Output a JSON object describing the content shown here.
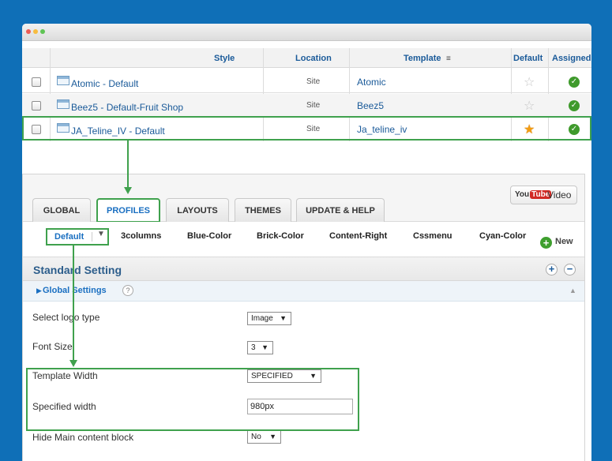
{
  "table": {
    "columns": {
      "style": "Style",
      "location": "Location",
      "template": "Template",
      "default": "Default",
      "assigned": "Assigned"
    },
    "rows": [
      {
        "style": "Atomic - Default",
        "location": "Site",
        "template": "Atomic",
        "is_default": false
      },
      {
        "style": "Beez5 - Default-Fruit Shop",
        "location": "Site",
        "template": "Beez5",
        "is_default": false
      },
      {
        "style": "JA_Teline_IV - Default",
        "location": "Site",
        "template": "Ja_teline_iv",
        "is_default": true
      }
    ]
  },
  "tabs": [
    "GLOBAL",
    "PROFILES",
    "LAYOUTS",
    "THEMES",
    "UPDATE & HELP"
  ],
  "active_tab": "PROFILES",
  "video_button": {
    "logo_you": "You",
    "logo_tube": "Tube",
    "label": "Video"
  },
  "profiles": {
    "selected": "Default",
    "items": [
      "3columns",
      "Blue-Color",
      "Brick-Color",
      "Content-Right",
      "Cssmenu",
      "Cyan-Color"
    ],
    "new_label": "New"
  },
  "standard_setting": {
    "title": "Standard Setting"
  },
  "global_settings": {
    "label": "Global Settings",
    "help": "?"
  },
  "form": {
    "logo_type": {
      "label": "Select logo type",
      "value": "Image"
    },
    "font_size": {
      "label": "Font Size",
      "value": "3"
    },
    "template_width": {
      "label": "Template Width",
      "value": "SPECIFIED"
    },
    "specified_width": {
      "label": "Specified width",
      "value": "980px"
    },
    "hide_main": {
      "label": "Hide Main content block",
      "value": "No"
    }
  },
  "colors": {
    "highlight": "#3fa14d",
    "link": "#1a5a99",
    "background": "#0f6fb7"
  }
}
